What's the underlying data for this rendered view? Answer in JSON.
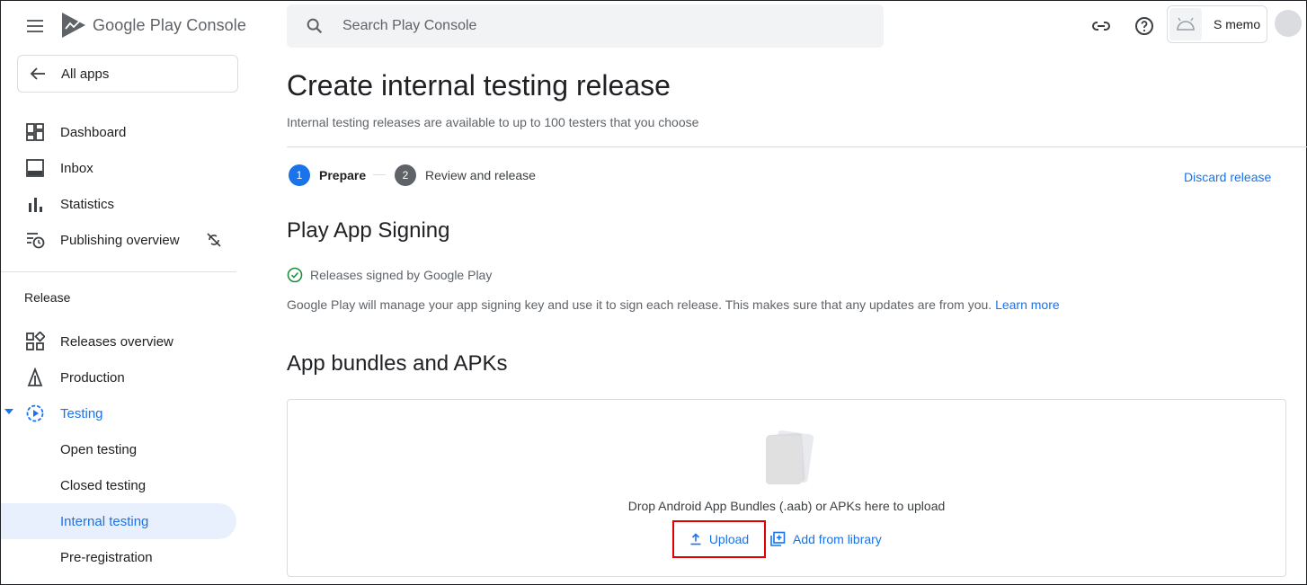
{
  "topbar": {
    "logo_text": "Google Play Console",
    "search_placeholder": "Search Play Console",
    "account_name": "S memo"
  },
  "sidebar": {
    "all_apps": "All apps",
    "items": [
      {
        "label": "Dashboard",
        "icon": "dashboard-icon"
      },
      {
        "label": "Inbox",
        "icon": "inbox-icon"
      },
      {
        "label": "Statistics",
        "icon": "statistics-icon"
      },
      {
        "label": "Publishing overview",
        "icon": "publishing-overview-icon"
      }
    ],
    "section_label": "Release",
    "release_items": [
      {
        "label": "Releases overview",
        "icon": "releases-overview-icon"
      },
      {
        "label": "Production",
        "icon": "production-icon"
      },
      {
        "label": "Testing",
        "icon": "testing-icon"
      },
      {
        "label": "Open testing"
      },
      {
        "label": "Closed testing"
      },
      {
        "label": "Internal testing"
      },
      {
        "label": "Pre-registration"
      }
    ]
  },
  "main": {
    "title": "Create internal testing release",
    "subtitle": "Internal testing releases are available to up to 100 testers that you choose",
    "steps": [
      {
        "num": "1",
        "label": "Prepare"
      },
      {
        "num": "2",
        "label": "Review and release"
      }
    ],
    "discard_label": "Discard release",
    "signing": {
      "heading": "Play App Signing",
      "status": "Releases signed by Google Play",
      "description": "Google Play will manage your app signing key and use it to sign each release. This makes sure that any updates are from you.",
      "learn_more": "Learn more"
    },
    "bundles": {
      "heading": "App bundles and APKs",
      "drop_text": "Drop Android App Bundles (.aab) or APKs here to upload",
      "upload_label": "Upload",
      "library_label": "Add from library"
    }
  },
  "colors": {
    "accent": "#1a73e8",
    "active_bg": "#e8f0fe",
    "highlight_border": "#e00000",
    "success": "#1e8e3e"
  }
}
